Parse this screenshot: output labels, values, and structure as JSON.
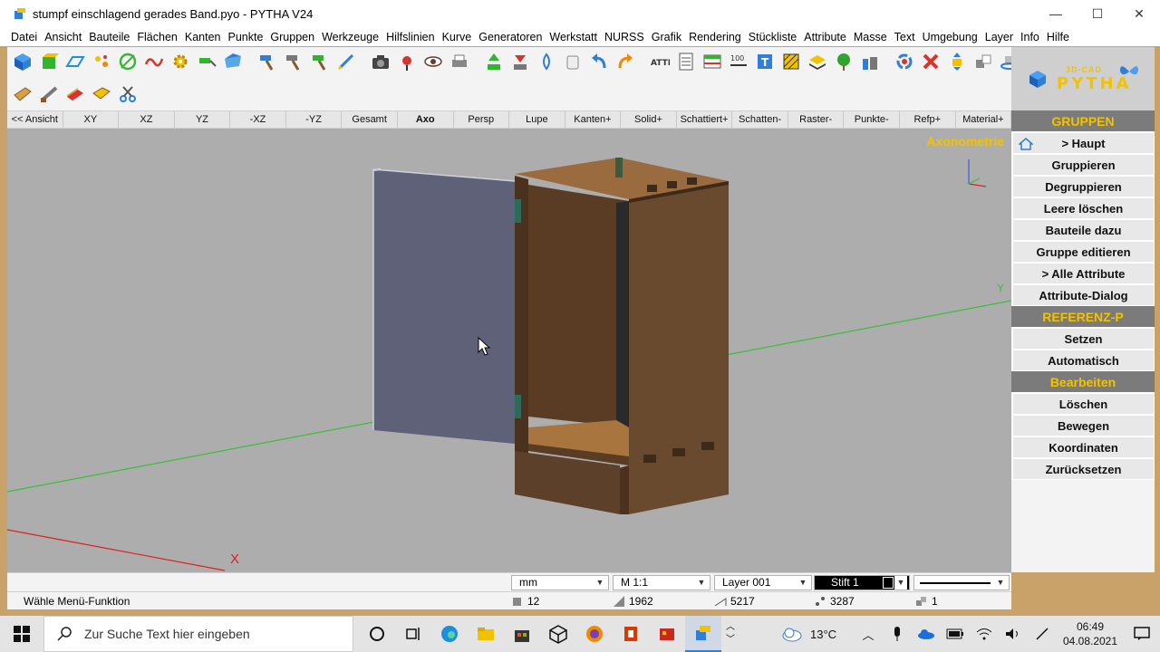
{
  "window": {
    "title": "stumpf einschlagend gerades Band.pyo - PYTHA V24",
    "minimize": "—",
    "maximize": "☐",
    "close": "✕"
  },
  "menu": [
    "Datei",
    "Ansicht",
    "Bauteile",
    "Flächen",
    "Kanten",
    "Punkte",
    "Gruppen",
    "Werkzeuge",
    "Hilfslinien",
    "Kurve",
    "Generatoren",
    "Werkstatt",
    "NURSS",
    "Grafik",
    "Rendering",
    "Stückliste",
    "Attribute",
    "Masse",
    "Text",
    "Umgebung",
    "Layer",
    "Info",
    "Hilfe"
  ],
  "viewbar": {
    "items": [
      "<< Ansicht",
      "XY",
      "XZ",
      "YZ",
      "-XZ",
      "-YZ",
      "Gesamt",
      "Axo",
      "Persp",
      "Lupe",
      "Kanten+",
      "Solid+",
      "Schattiert+",
      "Schatten-",
      "Raster-",
      "Punkte-",
      "Refp+",
      "Material+"
    ],
    "active": "Axo"
  },
  "viewport": {
    "label": "Axonometrie",
    "axis_x_label": "X",
    "axis_y_label": "Y"
  },
  "logo": {
    "small": "3D-CAD",
    "big": "PYTHA"
  },
  "panel": {
    "groups_header": "GRUPPEN",
    "home_item": "> Haupt",
    "group_items": [
      "Gruppieren",
      "Degruppieren",
      "Leere löschen",
      "Bauteile dazu",
      "Gruppe editieren",
      "> Alle Attribute",
      "Attribute-Dialog"
    ],
    "ref_header": "REFERENZ-P",
    "ref_items": [
      "Setzen",
      "Automatisch"
    ],
    "edit_header": "Bearbeiten",
    "edit_items": [
      "Löschen",
      "Bewegen",
      "Koordinaten",
      "Zurücksetzen"
    ]
  },
  "status": {
    "unit": "mm",
    "scale": "M 1:1",
    "layer": "Layer 001",
    "pen": "Stift 1",
    "prompt": "Wähle Menü-Funktion",
    "count_parts": "12",
    "count_faces": "1962",
    "count_edges": "5217",
    "count_points": "3287",
    "count_groups": "1"
  },
  "taskbar": {
    "search_placeholder": "Zur Suche Text hier eingeben",
    "temperature": "13°C",
    "time": "06:49",
    "date": "04.08.2021"
  },
  "colors": {
    "accent_yellow": "#f2c200",
    "panel_header": "#7b7b7b",
    "viewport_bg": "#adadad",
    "door": "#5e6178",
    "wood": "#6a4a2f"
  }
}
